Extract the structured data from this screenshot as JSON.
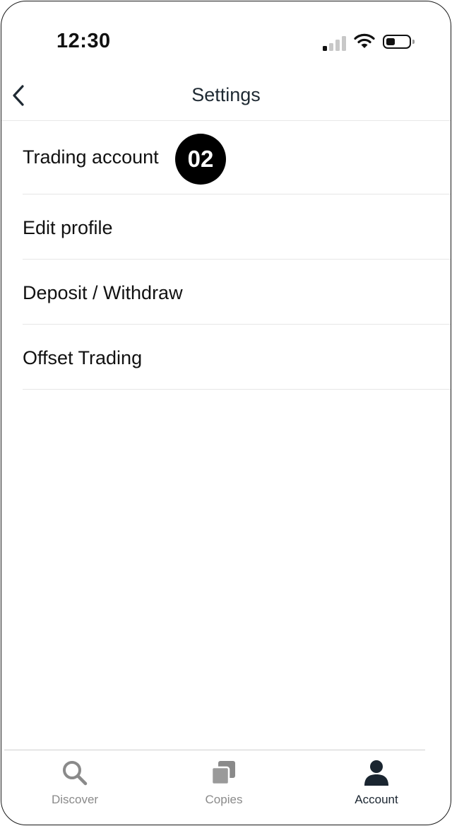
{
  "status_bar": {
    "time": "12:30"
  },
  "header": {
    "title": "Settings"
  },
  "settings": {
    "items": [
      {
        "label": "Trading account",
        "badge": "02"
      },
      {
        "label": "Edit profile"
      },
      {
        "label": "Deposit / Withdraw"
      },
      {
        "label": "Offset Trading"
      }
    ]
  },
  "tab_bar": {
    "tabs": [
      {
        "label": "Discover",
        "icon": "search-icon"
      },
      {
        "label": "Copies",
        "icon": "copies-icon"
      },
      {
        "label": "Account",
        "icon": "person-icon",
        "active": true
      }
    ]
  },
  "colors": {
    "active_tab": "#1a2530",
    "inactive_tab": "#8a8a8a",
    "badge": "#000000"
  }
}
